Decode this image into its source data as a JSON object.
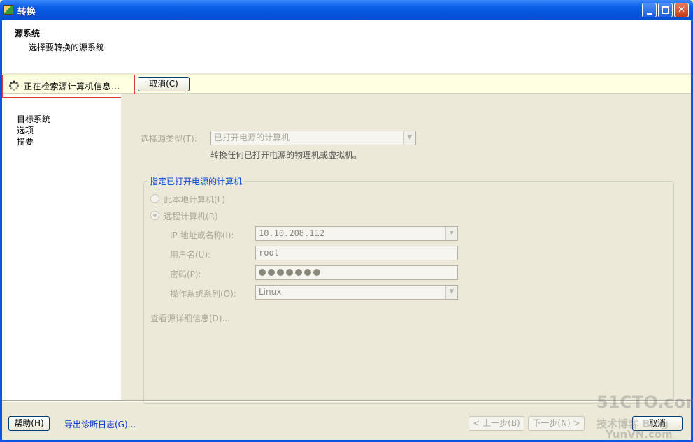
{
  "window": {
    "title": "转换"
  },
  "header": {
    "title": "源系统",
    "subtitle": "选择要转换的源系统"
  },
  "status": {
    "text": "正在检索源计算机信息...",
    "cancel_label": "取消(C)"
  },
  "nav": {
    "items": [
      {
        "label": "目标系统"
      },
      {
        "label": "选项"
      },
      {
        "label": "摘要"
      }
    ]
  },
  "source": {
    "type_label": "选择源类型(T):",
    "type_value": "已打开电源的计算机",
    "type_hint": "转换任何已打开电源的物理机或虚拟机。",
    "group_title": "指定已打开电源的计算机",
    "local_label": "此本地计算机(L)",
    "remote_label": "远程计算机(R)",
    "ip_label": "IP 地址或名称(I):",
    "ip_value": "10.10.208.112",
    "user_label": "用户名(U):",
    "user_value": "root",
    "password_label": "密码(P):",
    "password_masked_count": 7,
    "os_label": "操作系统系列(O):",
    "os_value": "Linux",
    "details_link": "查看源详细信息(D)..."
  },
  "footer": {
    "help_label": "帮助(H)",
    "export_link": "导出诊断日志(G)...",
    "back_label": "< 上一步(B)",
    "next_label": "下一步(N) >",
    "cancel_label": "取消"
  },
  "watermark": {
    "line1": "51CTO.com",
    "line2": "技术博客 Blog",
    "line3": "YunVN.com"
  },
  "colors": {
    "titlebar": "#0a5ee8",
    "link": "#0033cc",
    "group_title": "#0046d5",
    "highlight_border": "#e03a3a"
  }
}
